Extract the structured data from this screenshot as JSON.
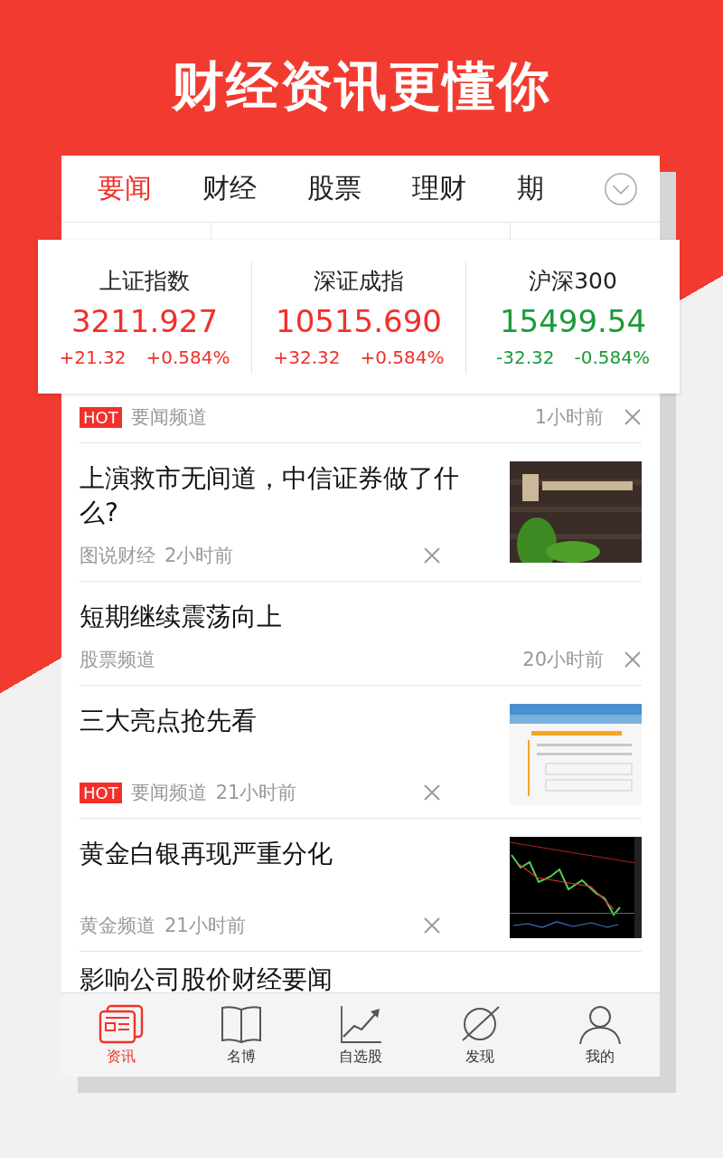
{
  "headline": "财经资讯更懂你",
  "tabs": [
    {
      "label": "要闻",
      "selected": true
    },
    {
      "label": "财经",
      "selected": false
    },
    {
      "label": "股票",
      "selected": false
    },
    {
      "label": "理财",
      "selected": false
    },
    {
      "label": "期",
      "selected": false
    }
  ],
  "indices": [
    {
      "name": "上证指数",
      "value": "3211.927",
      "change": "+21.32",
      "percent": "+0.584%",
      "kind": "up"
    },
    {
      "name": "深证成指",
      "value": "10515.690",
      "change": "+32.32",
      "percent": "+0.584%",
      "kind": "up"
    },
    {
      "name": "沪深300",
      "value": "15499.54",
      "change": "-32.32",
      "percent": "-0.584%",
      "kind": "down"
    }
  ],
  "news": [
    {
      "tag": "HOT",
      "channel": "要闻频道",
      "time": "1小时前"
    },
    {
      "title": "上演救市无间道，中信证券做了什么?",
      "channel": "图说财经",
      "time": "2小时前"
    },
    {
      "title": "短期继续震荡向上",
      "channel": "股票频道",
      "time": "20小时前"
    },
    {
      "title": "三大亮点抢先看",
      "tag": "HOT",
      "channel": "要闻频道",
      "time": "21小时前"
    },
    {
      "title": "黄金白银再现严重分化",
      "channel": "黄金频道",
      "time": "21小时前"
    },
    {
      "title": "影响公司股价财经要闻"
    }
  ],
  "nav": [
    {
      "label": "资讯",
      "selected": true
    },
    {
      "label": "名博",
      "selected": false
    },
    {
      "label": "自选股",
      "selected": false
    },
    {
      "label": "发现",
      "selected": false
    },
    {
      "label": "我的",
      "selected": false
    }
  ]
}
